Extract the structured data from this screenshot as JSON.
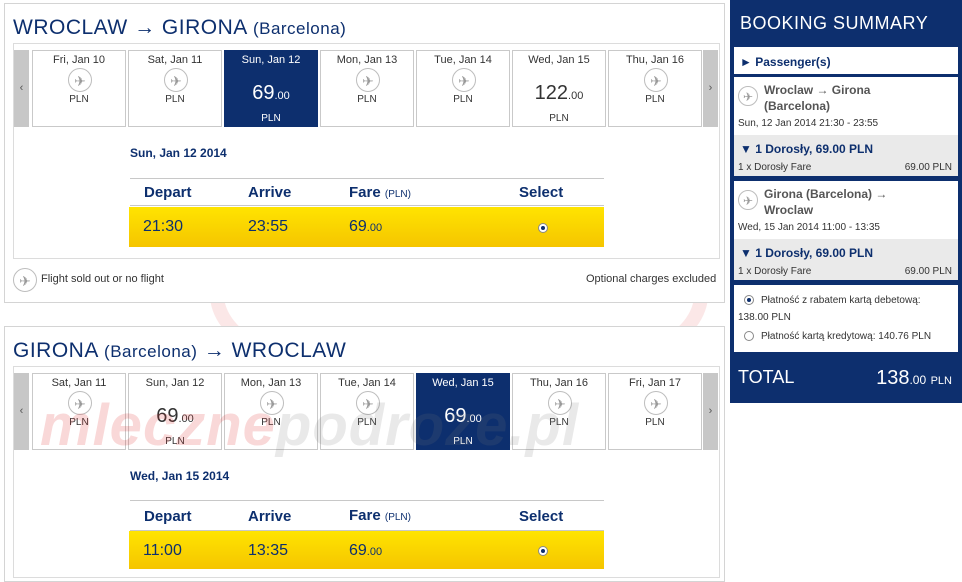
{
  "outbound": {
    "from": "WROCLAW",
    "arrow": "→",
    "to": "GIRONA",
    "to_sub": "(Barcelona)",
    "prev_label": "‹",
    "next_label": "›",
    "dates": [
      {
        "label": "Fri, Jan 10",
        "price": "",
        "cents": "",
        "currency": "PLN"
      },
      {
        "label": "Sat, Jan 11",
        "price": "",
        "cents": "",
        "currency": "PLN"
      },
      {
        "label": "Sun, Jan 12",
        "price": "69",
        "cents": ".00",
        "currency": "PLN",
        "selected": true
      },
      {
        "label": "Mon, Jan 13",
        "price": "",
        "cents": "",
        "currency": "PLN"
      },
      {
        "label": "Tue, Jan 14",
        "price": "",
        "cents": "",
        "currency": "PLN"
      },
      {
        "label": "Wed, Jan 15",
        "price": "122",
        "cents": ".00",
        "currency": "PLN"
      },
      {
        "label": "Thu, Jan 16",
        "price": "",
        "cents": "",
        "currency": "PLN"
      }
    ],
    "selected_date": "Sun, Jan 12 2014",
    "headers": {
      "depart": "Depart",
      "arrive": "Arrive",
      "fare": "Fare",
      "fare_unit": "(PLN)",
      "select": "Select"
    },
    "flight": {
      "depart": "21:30",
      "arrive": "23:55",
      "fare": "69",
      "fare_cents": ".00"
    },
    "legend": "Flight sold out or no flight",
    "optional": "Optional charges excluded"
  },
  "inbound": {
    "from": "GIRONA",
    "from_sub": "(Barcelona)",
    "arrow": "→",
    "to": "WROCLAW",
    "prev_label": "‹",
    "next_label": "›",
    "dates": [
      {
        "label": "Sat, Jan 11",
        "price": "",
        "cents": "",
        "currency": "PLN"
      },
      {
        "label": "Sun, Jan 12",
        "price": "69",
        "cents": ".00",
        "currency": "PLN"
      },
      {
        "label": "Mon, Jan 13",
        "price": "",
        "cents": "",
        "currency": "PLN"
      },
      {
        "label": "Tue, Jan 14",
        "price": "",
        "cents": "",
        "currency": "PLN"
      },
      {
        "label": "Wed, Jan 15",
        "price": "69",
        "cents": ".00",
        "currency": "PLN",
        "selected": true
      },
      {
        "label": "Thu, Jan 16",
        "price": "",
        "cents": "",
        "currency": "PLN"
      },
      {
        "label": "Fri, Jan 17",
        "price": "",
        "cents": "",
        "currency": "PLN"
      }
    ],
    "selected_date": "Wed, Jan 15 2014",
    "headers": {
      "depart": "Depart",
      "arrive": "Arrive",
      "fare": "Fare",
      "fare_unit": "(PLN)",
      "select": "Select"
    },
    "flight": {
      "depart": "11:00",
      "arrive": "13:35",
      "fare": "69",
      "fare_cents": ".00"
    }
  },
  "summary": {
    "title": "BOOKING SUMMARY",
    "passengers": "► Passenger(s)",
    "leg1": {
      "route1": "Wroclaw → Girona",
      "route2": "(Barcelona)",
      "when": "Sun, 12 Jan 2014 21:30 - 23:55",
      "fare_head": "▼ 1 Dorosły, 69.00 PLN",
      "fare_line": "1 x Dorosły Fare",
      "fare_amount": "69.00 PLN"
    },
    "leg2": {
      "route1": "Girona (Barcelona) →",
      "route2": "Wroclaw",
      "when": "Wed, 15 Jan 2014 11:00 - 13:35",
      "fare_head": "▼ 1 Dorosły, 69.00 PLN",
      "fare_line": "1 x Dorosły Fare",
      "fare_amount": "69.00 PLN"
    },
    "pay1_line1": "Płatność z rabatem kartą debetową:",
    "pay1_line2": "138.00 PLN",
    "pay2": "Płatność kartą kredytową: 140.76 PLN",
    "total_label": "TOTAL",
    "total_value": "138",
    "total_cents": ".00",
    "total_currency": "PLN"
  },
  "watermark": {
    "part1": "mleczne",
    "part2": "podroze.pl"
  },
  "colors": {
    "navy": "#0d2f6e",
    "yellow": "#ffd800"
  }
}
